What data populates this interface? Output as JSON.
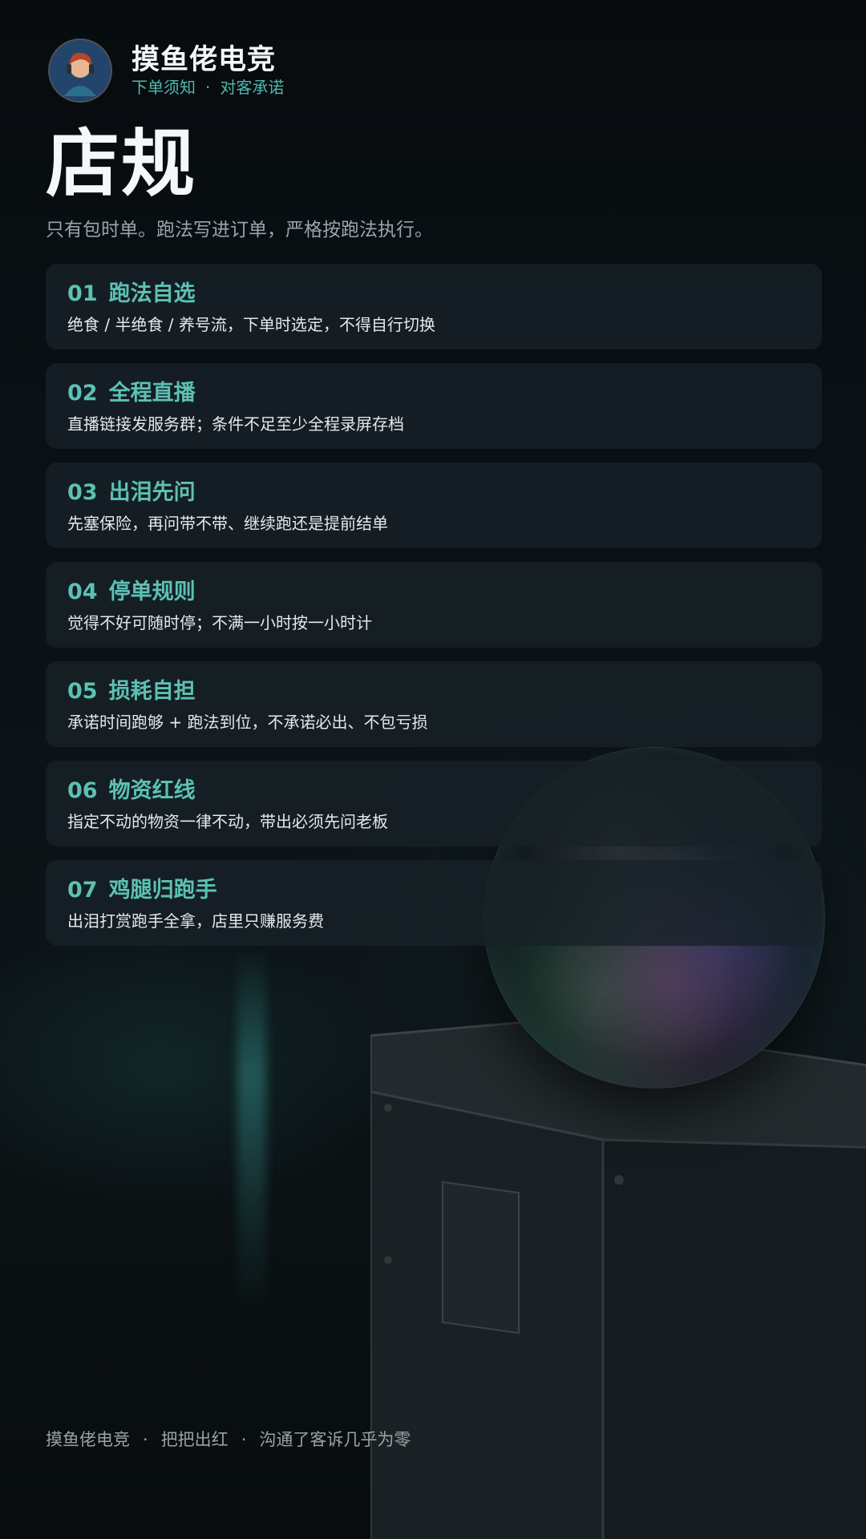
{
  "header": {
    "brand_name": "摸鱼佬电竞",
    "subtitle_left": "下单须知",
    "subtitle_sep": "·",
    "subtitle_right": "对客承诺"
  },
  "page": {
    "title": "店规",
    "subtitle": "只有包时单。跑法写进订单，严格按跑法执行。"
  },
  "rules": [
    {
      "num": "01",
      "title": "跑法自选",
      "desc": "绝食 / 半绝食 / 养号流，下单时选定，不得自行切换"
    },
    {
      "num": "02",
      "title": "全程直播",
      "desc": "直播链接发服务群；条件不足至少全程录屏存档"
    },
    {
      "num": "03",
      "title": "出泪先问",
      "desc": "先塞保险，再问带不带、继续跑还是提前结单"
    },
    {
      "num": "04",
      "title": "停单规则",
      "desc": "觉得不好可随时停；不满一小时按一小时计"
    },
    {
      "num": "05",
      "title": "损耗自担",
      "desc": "承诺时间跑够 + 跑法到位，不承诺必出、不包亏损"
    },
    {
      "num": "06",
      "title": "物资红线",
      "desc": "指定不动的物资一律不动，带出必须先问老板"
    },
    {
      "num": "07",
      "title": "鸡腿归跑手",
      "desc": "出泪打赏跑手全拿，店里只赚服务费"
    }
  ],
  "footer": {
    "part1": "摸鱼佬电竞",
    "part2": "把把出红",
    "part3": "沟通了客诉几乎为零",
    "sep": "·"
  },
  "colors": {
    "accent": "#5cc1b3",
    "background": "#080d11",
    "card": "#172128"
  },
  "icons": {
    "avatar": "avatar-portrait-icon"
  }
}
